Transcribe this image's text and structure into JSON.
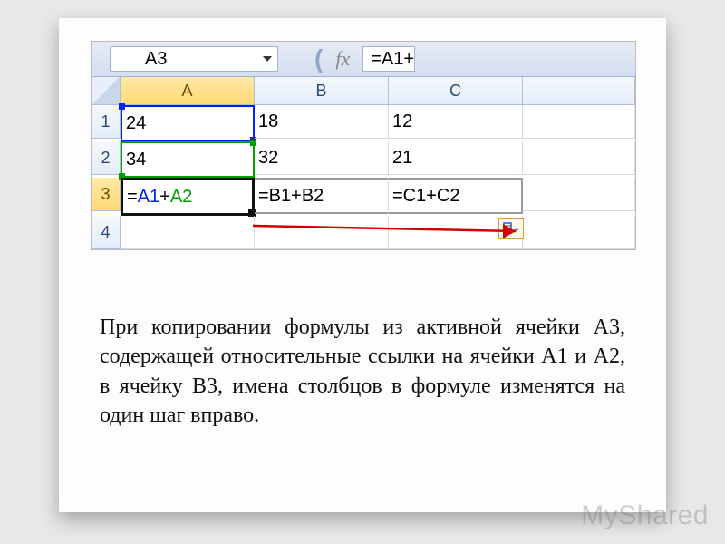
{
  "namebox": {
    "value": "A3"
  },
  "formula_bar": {
    "fx": "fx",
    "value": "=A1+"
  },
  "columns": [
    "A",
    "B",
    "C"
  ],
  "rows": [
    "1",
    "2",
    "3",
    "4"
  ],
  "cells": {
    "A1": "24",
    "B1": "18",
    "C1": "12",
    "A2": "34",
    "B2": "32",
    "C2": "21",
    "A3_pre": "=",
    "A3_ref1": "A1",
    "A3_op": "+",
    "A3_ref2": "A2",
    "B3": "=B1+B2",
    "C3": "=C1+C2"
  },
  "caption": "При копировании формулы из активной ячейки А3, содержащей относительные ссылки на ячейки А1 и А2, в ячейку В3, имена столбцов в формуле изменятся на один шаг вправо.",
  "watermark": "MyShared"
}
